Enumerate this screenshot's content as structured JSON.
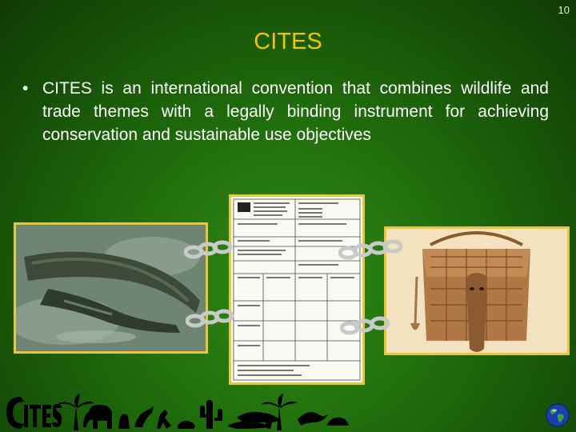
{
  "slide": {
    "number": "10",
    "title": "CITES",
    "bullets": [
      {
        "marker": "•",
        "text": "CITES is an international convention that combines wildlife and trade themes with a legally binding instrument for achieving conservation and sustainable use objectives"
      }
    ]
  },
  "images": {
    "left": "crocodile-photo",
    "center": "cites-permit-document",
    "right": "crocodile-leather-bag-photo"
  },
  "colors": {
    "title": "#f5c400",
    "text": "#ffffff",
    "frame": "#e9c63a",
    "background": "#2a7d12"
  }
}
